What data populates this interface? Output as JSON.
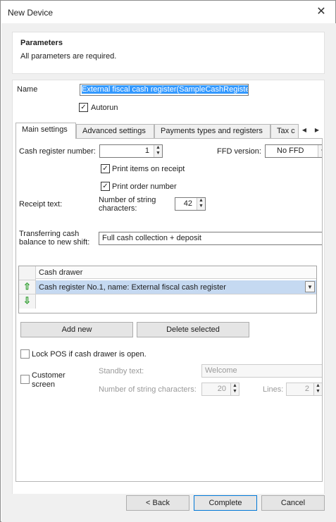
{
  "window": {
    "title": "New Device",
    "close_glyph": "✕"
  },
  "parameters": {
    "title": "Parameters",
    "description": "All parameters are required."
  },
  "name_section": {
    "name_label": "Name",
    "name_value": "External fiscal cash register(SampleCashRegister",
    "autorun_label": "Autorun",
    "autorun_checked": true
  },
  "tabs": [
    {
      "label": "Main settings",
      "active": true
    },
    {
      "label": "Advanced settings",
      "active": false
    },
    {
      "label": "Payments types and registers",
      "active": false
    },
    {
      "label": "Tax c",
      "active": false
    }
  ],
  "main": {
    "cash_register_number_label": "Cash register number:",
    "cash_register_number_value": "1",
    "ffd_version_label": "FFD version:",
    "ffd_version_value": "No FFD",
    "print_items_label": "Print items on receipt",
    "print_items_checked": true,
    "print_order_label": "Print order number",
    "print_order_checked": true,
    "receipt_text_label": "Receipt text:",
    "string_chars_label_1": "Number of string",
    "string_chars_label_2": "characters:",
    "string_chars_value": "42",
    "transfer_label_1": "Transferring cash",
    "transfer_label_2": "balance to new shift:",
    "transfer_value": "Full cash collection + deposit",
    "cash_drawer_header": "Cash drawer",
    "cash_drawer_row": "Cash register No.1, name: External fiscal cash register",
    "add_new_label": "Add new",
    "delete_selected_label": "Delete selected",
    "lock_pos_label": "Lock POS if cash drawer is open.",
    "lock_pos_checked": false,
    "customer_screen_label_1": "Customer",
    "customer_screen_label_2": "screen",
    "customer_screen_checked": false,
    "standby_text_label": "Standby text:",
    "standby_text_value": "Welcome",
    "customer_chars_label": "Number of string characters:",
    "customer_chars_value": "20",
    "lines_label": "Lines:",
    "lines_value": "2"
  },
  "footer": {
    "back_label": "< Back",
    "complete_label": "Complete",
    "cancel_label": "Cancel"
  },
  "icons": {
    "check": "✓",
    "spin_up": "▲",
    "spin_down": "▼",
    "arrow_up": "⇧",
    "arrow_down": "⇩",
    "scroll_left": "◀",
    "scroll_right": "▶"
  }
}
